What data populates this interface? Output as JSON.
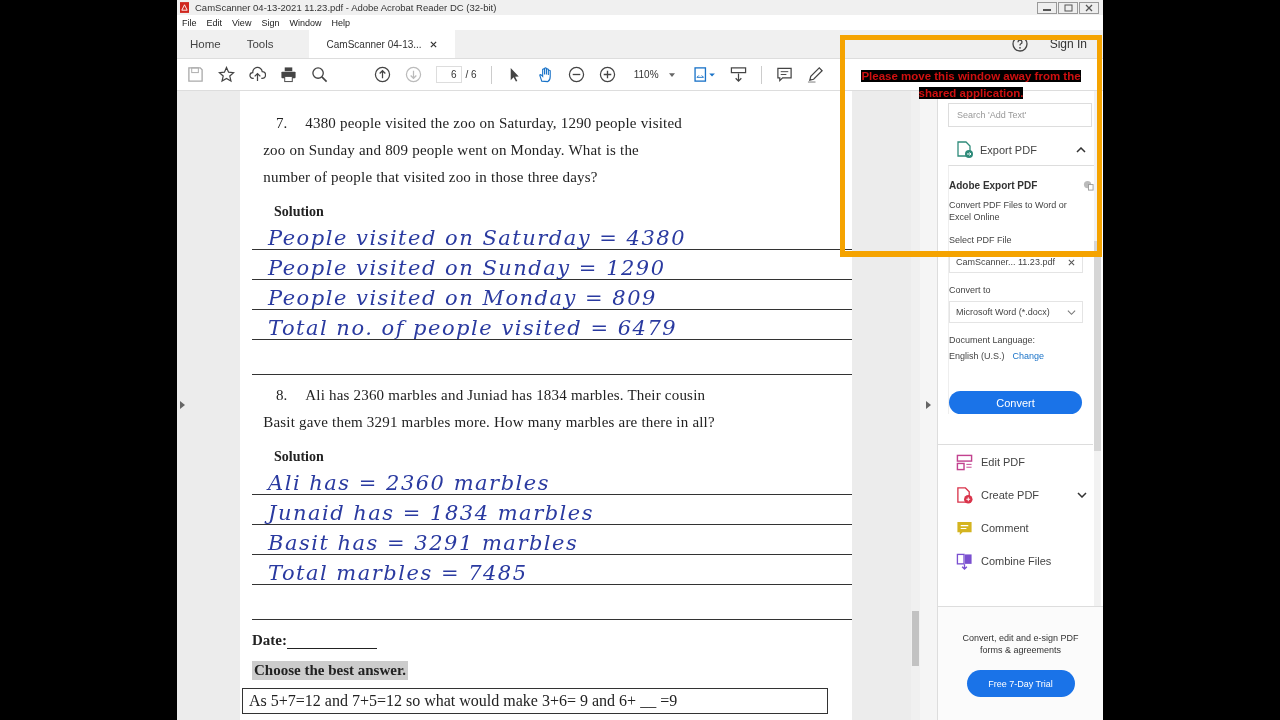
{
  "window": {
    "title": "CamScanner 04-13-2021 11.23.pdf - Adobe Acrobat Reader DC (32-bit)"
  },
  "menu": [
    "File",
    "Edit",
    "View",
    "Sign",
    "Window",
    "Help"
  ],
  "tabs": [
    {
      "label": "Home",
      "selected": false,
      "closable": false
    },
    {
      "label": "Tools",
      "selected": false,
      "closable": false
    },
    {
      "label": "CamScanner 04-13...",
      "selected": true,
      "closable": true
    }
  ],
  "sign_in": "Sign In",
  "toolbar": {
    "page_current": "6",
    "page_total": "/ 6",
    "zoom": "110%"
  },
  "document": {
    "questions": [
      {
        "number": "7.",
        "lines": [
          "4380 people visited the zoo on Saturday, 1290 people visited",
          "zoo on Sunday and 809 people went on  Monday. What is the",
          "number of people that visited zoo in those three days?"
        ],
        "solution_label": "Solution",
        "answers": [
          "People visited on Saturday = 4380",
          "People visited on Sunday = 1290",
          "People visited on Monday = 809",
          "Total no. of people visited = 6479"
        ]
      },
      {
        "number": "8.",
        "lines": [
          "Ali has 2360 marbles and Juniad has 1834 marbles. Their cousin",
          "Basit gave them 3291 marbles more. How many marbles are there in all?"
        ],
        "solution_label": "Solution",
        "answers": [
          "Ali has = 2360 marbles",
          "Junaid has = 1834 marbles",
          "Basit has = 3291 marbles",
          "Total marbles = 7485"
        ]
      }
    ],
    "date_label": "Date:",
    "section_heading": "Choose the best answer.",
    "question_box": "As 5+7=12 and 7+5=12 so what would make 3+6= 9 and 6+ __ =9"
  },
  "right_panel": {
    "search": {
      "placeholder": "Search 'Add Text'"
    },
    "export": {
      "title": "Export PDF",
      "expanded": true,
      "heading": "Adobe Export PDF",
      "description": "Convert PDF Files to Word or Excel Online",
      "file_label": "Select PDF File",
      "file": "CamScanner... 11.23.pdf",
      "convert_to_label": "Convert to",
      "format": "Microsoft Word (*.docx)",
      "language_label": "Document Language:",
      "language": "English (U.S.)",
      "change_link": "Change",
      "button": "Convert"
    },
    "tools": [
      {
        "label": "Edit PDF",
        "kind": "edit",
        "expandable": false
      },
      {
        "label": "Create PDF",
        "kind": "create",
        "expandable": true
      },
      {
        "label": "Comment",
        "kind": "comment",
        "expandable": false
      },
      {
        "label": "Combine Files",
        "kind": "combine",
        "expandable": false
      }
    ],
    "promo": {
      "text": "Convert, edit and e-sign PDF forms & agreements",
      "button": "Free 7-Day Trial"
    }
  },
  "share_warning": "Please move this window away from the shared application."
}
